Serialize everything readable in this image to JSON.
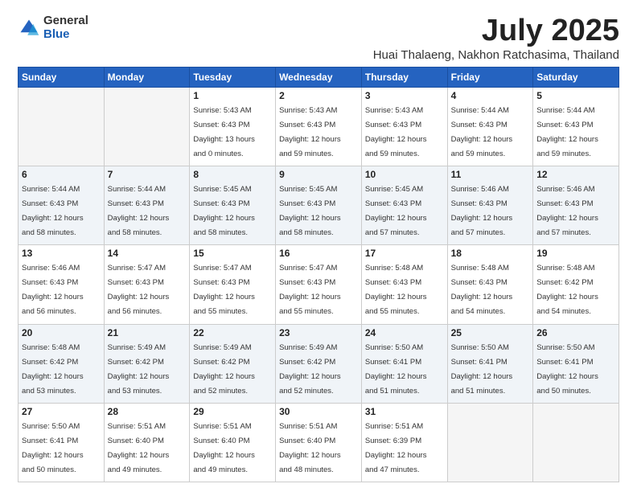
{
  "logo": {
    "general": "General",
    "blue": "Blue"
  },
  "header": {
    "month": "July 2025",
    "location": "Huai Thalaeng, Nakhon Ratchasima, Thailand"
  },
  "weekdays": [
    "Sunday",
    "Monday",
    "Tuesday",
    "Wednesday",
    "Thursday",
    "Friday",
    "Saturday"
  ],
  "weeks": [
    [
      {
        "day": "",
        "empty": true
      },
      {
        "day": "",
        "empty": true
      },
      {
        "day": "1",
        "info": "Sunrise: 5:43 AM\nSunset: 6:43 PM\nDaylight: 13 hours\nand 0 minutes."
      },
      {
        "day": "2",
        "info": "Sunrise: 5:43 AM\nSunset: 6:43 PM\nDaylight: 12 hours\nand 59 minutes."
      },
      {
        "day": "3",
        "info": "Sunrise: 5:43 AM\nSunset: 6:43 PM\nDaylight: 12 hours\nand 59 minutes."
      },
      {
        "day": "4",
        "info": "Sunrise: 5:44 AM\nSunset: 6:43 PM\nDaylight: 12 hours\nand 59 minutes."
      },
      {
        "day": "5",
        "info": "Sunrise: 5:44 AM\nSunset: 6:43 PM\nDaylight: 12 hours\nand 59 minutes."
      }
    ],
    [
      {
        "day": "6",
        "info": "Sunrise: 5:44 AM\nSunset: 6:43 PM\nDaylight: 12 hours\nand 58 minutes."
      },
      {
        "day": "7",
        "info": "Sunrise: 5:44 AM\nSunset: 6:43 PM\nDaylight: 12 hours\nand 58 minutes."
      },
      {
        "day": "8",
        "info": "Sunrise: 5:45 AM\nSunset: 6:43 PM\nDaylight: 12 hours\nand 58 minutes."
      },
      {
        "day": "9",
        "info": "Sunrise: 5:45 AM\nSunset: 6:43 PM\nDaylight: 12 hours\nand 58 minutes."
      },
      {
        "day": "10",
        "info": "Sunrise: 5:45 AM\nSunset: 6:43 PM\nDaylight: 12 hours\nand 57 minutes."
      },
      {
        "day": "11",
        "info": "Sunrise: 5:46 AM\nSunset: 6:43 PM\nDaylight: 12 hours\nand 57 minutes."
      },
      {
        "day": "12",
        "info": "Sunrise: 5:46 AM\nSunset: 6:43 PM\nDaylight: 12 hours\nand 57 minutes."
      }
    ],
    [
      {
        "day": "13",
        "info": "Sunrise: 5:46 AM\nSunset: 6:43 PM\nDaylight: 12 hours\nand 56 minutes."
      },
      {
        "day": "14",
        "info": "Sunrise: 5:47 AM\nSunset: 6:43 PM\nDaylight: 12 hours\nand 56 minutes."
      },
      {
        "day": "15",
        "info": "Sunrise: 5:47 AM\nSunset: 6:43 PM\nDaylight: 12 hours\nand 55 minutes."
      },
      {
        "day": "16",
        "info": "Sunrise: 5:47 AM\nSunset: 6:43 PM\nDaylight: 12 hours\nand 55 minutes."
      },
      {
        "day": "17",
        "info": "Sunrise: 5:48 AM\nSunset: 6:43 PM\nDaylight: 12 hours\nand 55 minutes."
      },
      {
        "day": "18",
        "info": "Sunrise: 5:48 AM\nSunset: 6:43 PM\nDaylight: 12 hours\nand 54 minutes."
      },
      {
        "day": "19",
        "info": "Sunrise: 5:48 AM\nSunset: 6:42 PM\nDaylight: 12 hours\nand 54 minutes."
      }
    ],
    [
      {
        "day": "20",
        "info": "Sunrise: 5:48 AM\nSunset: 6:42 PM\nDaylight: 12 hours\nand 53 minutes."
      },
      {
        "day": "21",
        "info": "Sunrise: 5:49 AM\nSunset: 6:42 PM\nDaylight: 12 hours\nand 53 minutes."
      },
      {
        "day": "22",
        "info": "Sunrise: 5:49 AM\nSunset: 6:42 PM\nDaylight: 12 hours\nand 52 minutes."
      },
      {
        "day": "23",
        "info": "Sunrise: 5:49 AM\nSunset: 6:42 PM\nDaylight: 12 hours\nand 52 minutes."
      },
      {
        "day": "24",
        "info": "Sunrise: 5:50 AM\nSunset: 6:41 PM\nDaylight: 12 hours\nand 51 minutes."
      },
      {
        "day": "25",
        "info": "Sunrise: 5:50 AM\nSunset: 6:41 PM\nDaylight: 12 hours\nand 51 minutes."
      },
      {
        "day": "26",
        "info": "Sunrise: 5:50 AM\nSunset: 6:41 PM\nDaylight: 12 hours\nand 50 minutes."
      }
    ],
    [
      {
        "day": "27",
        "info": "Sunrise: 5:50 AM\nSunset: 6:41 PM\nDaylight: 12 hours\nand 50 minutes."
      },
      {
        "day": "28",
        "info": "Sunrise: 5:51 AM\nSunset: 6:40 PM\nDaylight: 12 hours\nand 49 minutes."
      },
      {
        "day": "29",
        "info": "Sunrise: 5:51 AM\nSunset: 6:40 PM\nDaylight: 12 hours\nand 49 minutes."
      },
      {
        "day": "30",
        "info": "Sunrise: 5:51 AM\nSunset: 6:40 PM\nDaylight: 12 hours\nand 48 minutes."
      },
      {
        "day": "31",
        "info": "Sunrise: 5:51 AM\nSunset: 6:39 PM\nDaylight: 12 hours\nand 47 minutes."
      },
      {
        "day": "",
        "empty": true
      },
      {
        "day": "",
        "empty": true
      }
    ]
  ]
}
